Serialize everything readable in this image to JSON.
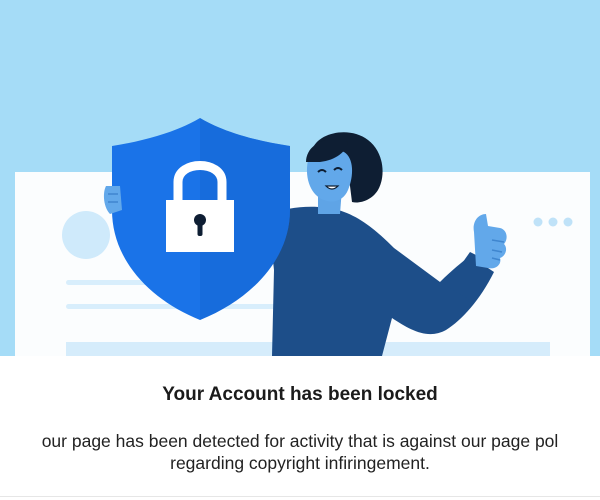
{
  "notice": {
    "title": "Your Account has been locked",
    "message_line1": "our page has been detected for activity that is against our page pol",
    "message_line2": "regarding copyright infiringement."
  },
  "illustration": {
    "icons": [
      "shield-icon",
      "padlock-icon",
      "thumbs-up-icon",
      "more-dots-icon"
    ]
  },
  "colors": {
    "sky": "#a5dcf7",
    "card": "#ffffff",
    "shield": "#1a73e8",
    "figure_dark": "#1d4e89",
    "skin": "#62a8ea"
  }
}
